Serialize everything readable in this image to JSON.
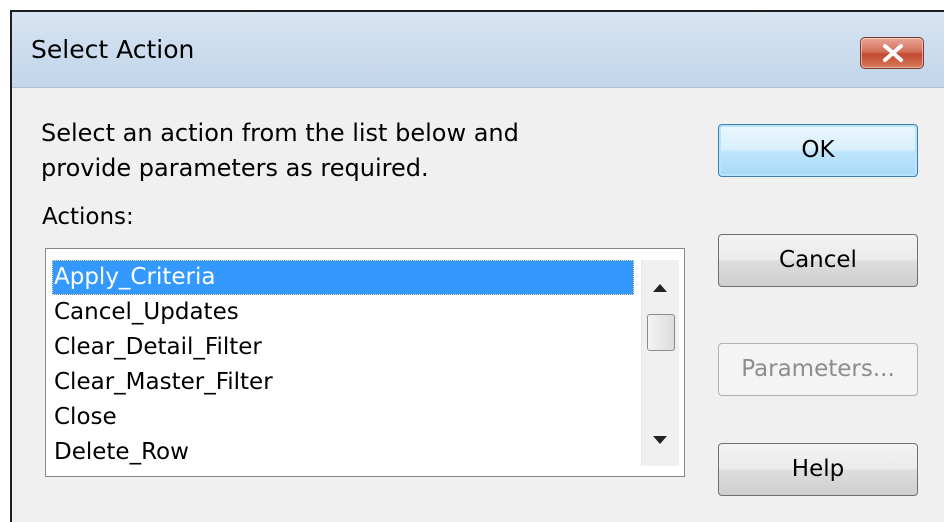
{
  "window": {
    "title": "Select Action",
    "close_icon": "close-icon"
  },
  "instructions": {
    "line1": "Select an action from the list below and",
    "line2": "provide parameters as required."
  },
  "actions_label": "Actions:",
  "actions": {
    "selected_index": 0,
    "items": [
      "Apply_Criteria",
      "Cancel_Updates",
      "Clear_Detail_Filter",
      "Clear_Master_Filter",
      "Close",
      "Delete_Row"
    ]
  },
  "buttons": {
    "ok": "OK",
    "cancel": "Cancel",
    "parameters": "Parameters...",
    "help": "Help"
  },
  "colors": {
    "selection": "#3399ff",
    "close_button": "#c24a30",
    "default_button_border": "#3c7fb1",
    "disabled_text": "#8d8d8d"
  },
  "icons": {
    "scroll_up": "arrow-up-icon",
    "scroll_down": "arrow-down-icon"
  }
}
